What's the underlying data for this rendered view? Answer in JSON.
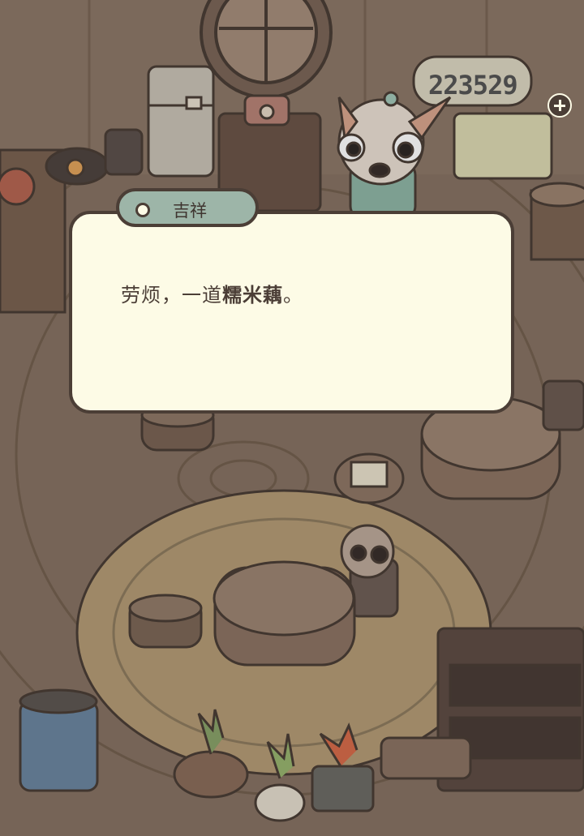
{
  "game": {
    "currency": {
      "value": "223529"
    },
    "dialog": {
      "speaker": "吉祥",
      "line_prefix": "劳烦，一道",
      "line_item": "糯米藕",
      "line_suffix": "。"
    }
  }
}
